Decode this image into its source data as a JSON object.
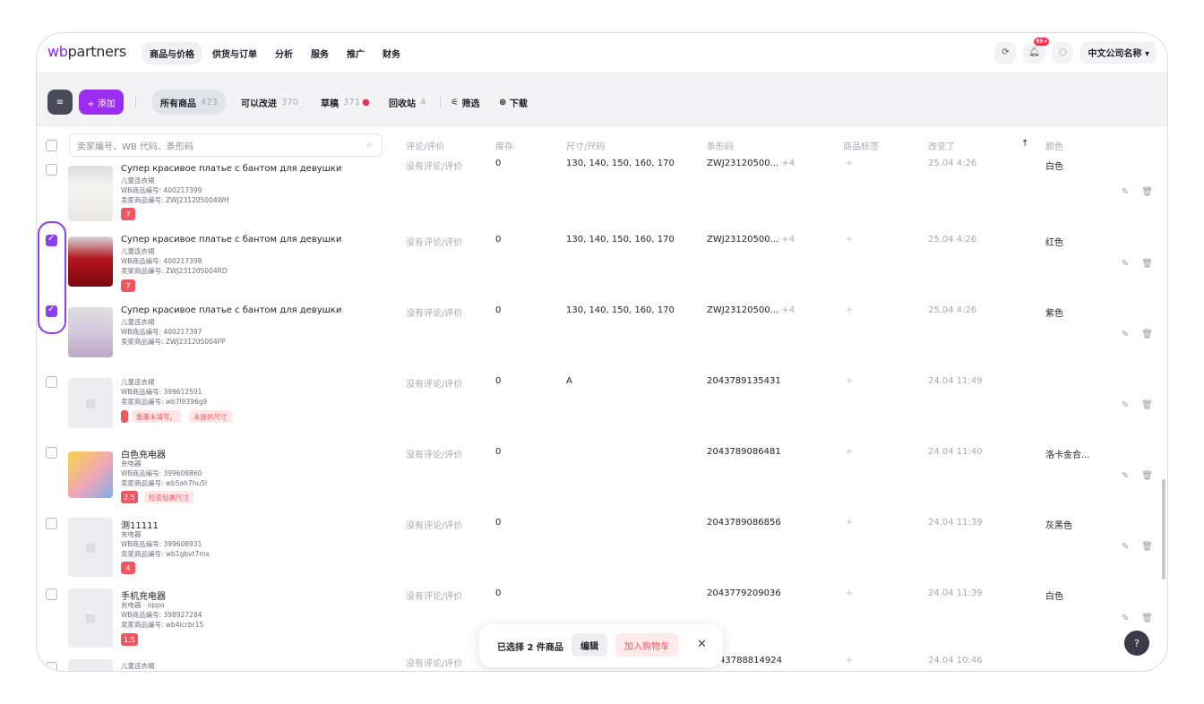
{
  "brand": {
    "logo_prefix": "wb",
    "logo_suffix": "partners"
  },
  "nav": {
    "items": [
      "商品与价格",
      "供货与订单",
      "分析",
      "服务",
      "推广",
      "财务"
    ],
    "active": "商品与价格",
    "notif_badge": "99+",
    "company": "中文公司名称",
    "company_chevron": "▾"
  },
  "toolbar": {
    "menu_icon": "≡",
    "add_label": "+ 添加",
    "tabs": [
      {
        "label": "所有商品",
        "count": "423"
      },
      {
        "label": "可以改进",
        "count": "370"
      },
      {
        "label": "草稿",
        "count": "371"
      },
      {
        "label": "回收站",
        "count": "4"
      }
    ],
    "filter_icon": "⚟",
    "filter_label": "筛选",
    "download_icon": "⊕",
    "download_label": "下载"
  },
  "table": {
    "search_placeholder": "卖家编号、WB 代码、条形码",
    "headers": {
      "reviews": "评论/评价",
      "stock": "库存",
      "size": "尺寸/尺码",
      "barcode": "条形码",
      "tags": "商品标签",
      "changed": "改变了",
      "sort_arrow": "↑",
      "color": "颜色"
    },
    "rows": [
      {
        "name": "Супер красивое платье с бантом для девушки",
        "category": "儿童连衣裙",
        "wb_id": "WB商品编号: 400217399",
        "seller_id": "卖家商品编号: ZWJ231205004WH",
        "rating": "7",
        "warnings": [],
        "reviews": "没有评论/评价",
        "stock": "0",
        "size": "130, 140, 150, 160, 170",
        "barcode": "ZWJ23120500...",
        "barcode_more": "+4",
        "tags": "+",
        "changed": "25.04 4:26",
        "color": "白色",
        "checked": false
      },
      {
        "name": "Супер красивое платье с бантом для девушки",
        "category": "儿童连衣裙",
        "wb_id": "WB商品编号: 400217398",
        "seller_id": "卖家商品编号: ZWJ231205004RD",
        "rating": "7",
        "warnings": [],
        "reviews": "没有评论/评价",
        "stock": "0",
        "size": "130, 140, 150, 160, 170",
        "barcode": "ZWJ23120500...",
        "barcode_more": "+4",
        "tags": "+",
        "changed": "25.04 4:26",
        "color": "红色",
        "checked": true
      },
      {
        "name": "Супер красивое платье с бантом для девушки",
        "category": "儿童连衣裙",
        "wb_id": "WB商品编号: 400217397",
        "seller_id": "卖家商品编号: ZWJ231205004PP",
        "rating": "",
        "warnings": [],
        "reviews": "没有评论/评价",
        "stock": "0",
        "size": "130, 140, 150, 160, 170",
        "barcode": "ZWJ23120500...",
        "barcode_more": "+4",
        "tags": "+",
        "changed": "25.04 4:26",
        "color": "紫色",
        "checked": true
      },
      {
        "name": "",
        "category": "儿童连衣裙",
        "wb_id": "WB商品编号: 399612591",
        "seller_id": "卖家商品编号: wb7l9396g9",
        "rating": "",
        "warnings": [
          "重量未填写。",
          "未提供尺寸"
        ],
        "reviews": "没有评论/评价",
        "stock": "0",
        "size": "A",
        "barcode": "2043789135431",
        "barcode_more": "",
        "tags": "+",
        "changed": "24.04 11:49",
        "color": "",
        "checked": false
      },
      {
        "name": "白色充电器",
        "category": "充电器",
        "wb_id": "WB商品编号: 399608860",
        "seller_id": "卖家商品编号: wb5ah7hu5l",
        "rating": "2.5",
        "warnings": [
          "检查包裹尺寸"
        ],
        "reviews": "没有评论/评价",
        "stock": "0",
        "size": "",
        "barcode": "2043789086481",
        "barcode_more": "",
        "tags": "+",
        "changed": "24.04 11:40",
        "color": "洛卡金合...",
        "checked": false
      },
      {
        "name": "测11111",
        "category": "充电器",
        "wb_id": "WB商品编号: 399608931",
        "seller_id": "卖家商品编号: wb1gbvt7mx",
        "rating": "4",
        "warnings": [],
        "reviews": "没有评论/评价",
        "stock": "0",
        "size": "",
        "barcode": "2043789086856",
        "barcode_more": "",
        "tags": "+",
        "changed": "24.04 11:39",
        "color": "灰黑色",
        "checked": false
      },
      {
        "name": "手机充电器",
        "category": "充电器 · oppo",
        "wb_id": "WB商品编号: 398927284",
        "seller_id": "卖家商品编号: wb4icrbr15",
        "rating": "1.5",
        "warnings": [],
        "reviews": "没有评论/评价",
        "stock": "0",
        "size": "",
        "barcode": "2043779209036",
        "barcode_more": "",
        "tags": "+",
        "changed": "24.04 11:39",
        "color": "白色",
        "checked": false
      },
      {
        "name": "",
        "category": "儿童连衣裙",
        "wb_id": "",
        "seller_id": "",
        "rating": "",
        "warnings": [],
        "reviews": "没有评论/评价",
        "stock": "",
        "size": "",
        "barcode": "43788814924",
        "barcode_more": "",
        "tags": "+",
        "changed": "24.04 10:46",
        "color": "",
        "checked": false
      }
    ]
  },
  "bulk_bar": {
    "text": "已选择 2 件商品",
    "edit": "编辑",
    "cart": "加入购物车",
    "close": "✕"
  },
  "help": "?"
}
